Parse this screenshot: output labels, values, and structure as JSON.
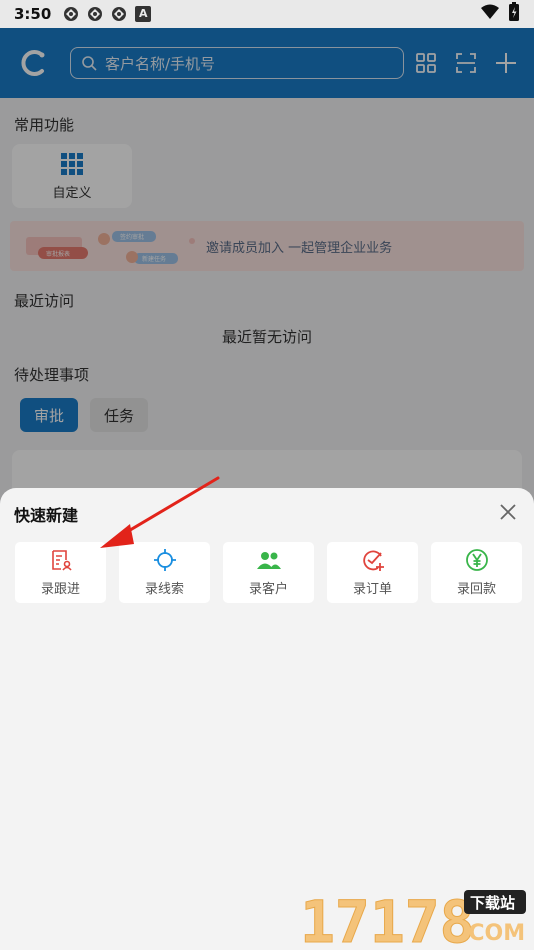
{
  "status_bar": {
    "time": "3:50",
    "notif_letter": "A"
  },
  "header": {
    "search_placeholder": "客户名称/手机号"
  },
  "common": {
    "title": "常用功能",
    "custom_label": "自定义"
  },
  "banner": {
    "text": "邀请成员加入  一起管理企业业务",
    "art_label_1": "审批报表",
    "art_label_2": "签约审批",
    "art_label_3": "新建任务"
  },
  "recent": {
    "title": "最近访问",
    "empty_text": "最近暂无访问"
  },
  "pending": {
    "title": "待处理事项",
    "tabs": [
      {
        "label": "审批",
        "active": true
      },
      {
        "label": "任务",
        "active": false
      }
    ]
  },
  "sheet": {
    "title": "快速新建",
    "actions": [
      {
        "label": "录跟进",
        "icon": "follow-up-icon",
        "color": "#e0443d"
      },
      {
        "label": "录线索",
        "icon": "target-icon",
        "color": "#1a8ee0"
      },
      {
        "label": "录客户",
        "icon": "customers-icon",
        "color": "#39b54a"
      },
      {
        "label": "录订单",
        "icon": "order-check-icon",
        "color": "#e0443d"
      },
      {
        "label": "录回款",
        "icon": "yen-icon",
        "color": "#39b54a"
      }
    ]
  },
  "watermark": {
    "number": "17178",
    "tag": "下载站",
    "domain": ".COM"
  },
  "colors": {
    "primary": "#1a7cc8",
    "annotation": "#e2231a"
  }
}
